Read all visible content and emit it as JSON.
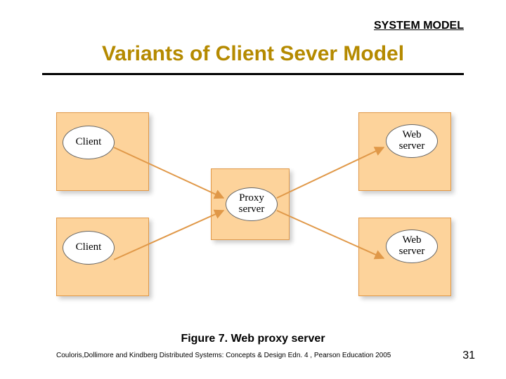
{
  "header": {
    "label": "SYSTEM MODEL"
  },
  "title": {
    "text": "Variants of Client Sever Model",
    "color": "#b58a00"
  },
  "nodes": {
    "client1": "Client",
    "client2": "Client",
    "proxy": "Proxy server",
    "web1": "Web server",
    "web2": "Web server"
  },
  "caption": "Figure 7. Web proxy server",
  "citation": "Couloris,Dollimore and Kindberg  Distributed Systems: Concepts & Design  Edn. 4 , Pearson Education 2005",
  "page_number": "31",
  "arrow_color": "#e09848"
}
